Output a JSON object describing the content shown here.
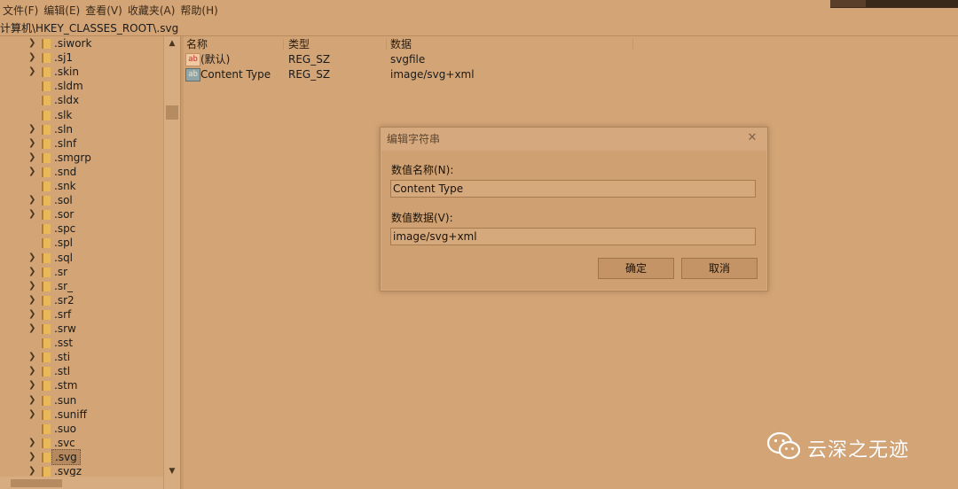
{
  "menu": [
    "文件(F)",
    "编辑(E)",
    "查看(V)",
    "收藏夹(A)",
    "帮助(H)"
  ],
  "address": "计算机\\HKEY_CLASSES_ROOT\\.svg",
  "tree": {
    "items": [
      {
        "label": ".siwork",
        "expandable": true
      },
      {
        "label": ".sj1",
        "expandable": true
      },
      {
        "label": ".skin",
        "expandable": true
      },
      {
        "label": ".sldm",
        "expandable": false
      },
      {
        "label": ".sldx",
        "expandable": false
      },
      {
        "label": ".slk",
        "expandable": false
      },
      {
        "label": ".sln",
        "expandable": true
      },
      {
        "label": ".slnf",
        "expandable": true
      },
      {
        "label": ".smgrp",
        "expandable": true
      },
      {
        "label": ".snd",
        "expandable": true
      },
      {
        "label": ".snk",
        "expandable": false
      },
      {
        "label": ".sol",
        "expandable": true
      },
      {
        "label": ".sor",
        "expandable": true
      },
      {
        "label": ".spc",
        "expandable": false
      },
      {
        "label": ".spl",
        "expandable": false
      },
      {
        "label": ".sql",
        "expandable": true
      },
      {
        "label": ".sr",
        "expandable": true
      },
      {
        "label": ".sr_",
        "expandable": true
      },
      {
        "label": ".sr2",
        "expandable": true
      },
      {
        "label": ".srf",
        "expandable": true
      },
      {
        "label": ".srw",
        "expandable": true
      },
      {
        "label": ".sst",
        "expandable": false
      },
      {
        "label": ".sti",
        "expandable": true
      },
      {
        "label": ".stl",
        "expandable": true
      },
      {
        "label": ".stm",
        "expandable": true
      },
      {
        "label": ".sun",
        "expandable": true
      },
      {
        "label": ".suniff",
        "expandable": true
      },
      {
        "label": ".suo",
        "expandable": false
      },
      {
        "label": ".svc",
        "expandable": true
      },
      {
        "label": ".svg",
        "expandable": true,
        "selected": true
      },
      {
        "label": ".svgz",
        "expandable": true
      }
    ]
  },
  "list": {
    "headers": {
      "name": "名称",
      "type": "类型",
      "data": "数据"
    },
    "rows": [
      {
        "icon": "string-value-icon",
        "name": "(默认)",
        "type": "REG_SZ",
        "data": "svgfile"
      },
      {
        "icon": "string-value-icon",
        "name": "Content Type",
        "type": "REG_SZ",
        "data": "image/svg+xml"
      }
    ]
  },
  "dialog": {
    "title": "编辑字符串",
    "name_label": "数值名称(N):",
    "name_value": "Content Type",
    "data_label": "数值数据(V):",
    "data_value": "image/svg+xml",
    "ok": "确定",
    "cancel": "取消"
  },
  "watermark": "云深之无迹",
  "colors": {
    "background": "#d2a476",
    "selection": "#b5885d",
    "folder": "#e8b85a"
  }
}
